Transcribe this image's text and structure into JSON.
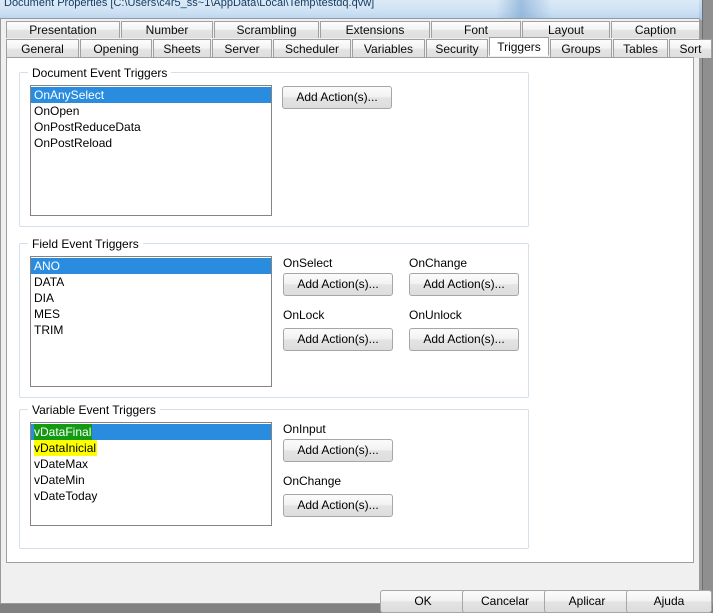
{
  "window": {
    "title": "Document Properties [C:\\Users\\c4r5_ss~1\\AppData\\Local\\Temp\\testdq.qvw]"
  },
  "tabs": {
    "row1": [
      {
        "label": "Presentation",
        "selected": false
      },
      {
        "label": "Number",
        "selected": false
      },
      {
        "label": "Scrambling",
        "selected": false
      },
      {
        "label": "Extensions",
        "selected": false
      },
      {
        "label": "Font",
        "selected": false
      },
      {
        "label": "Layout",
        "selected": false
      },
      {
        "label": "Caption",
        "selected": false
      }
    ],
    "row2": [
      {
        "label": "General",
        "selected": false
      },
      {
        "label": "Opening",
        "selected": false
      },
      {
        "label": "Sheets",
        "selected": false
      },
      {
        "label": "Server",
        "selected": false
      },
      {
        "label": "Scheduler",
        "selected": false
      },
      {
        "label": "Variables",
        "selected": false
      },
      {
        "label": "Security",
        "selected": false
      },
      {
        "label": "Triggers",
        "selected": true
      },
      {
        "label": "Groups",
        "selected": false
      },
      {
        "label": "Tables",
        "selected": false
      },
      {
        "label": "Sort",
        "selected": false
      }
    ]
  },
  "document_group": {
    "title": "Document Event Triggers",
    "items": [
      {
        "label": "OnAnySelect",
        "selected": true,
        "highlight": "none"
      },
      {
        "label": "OnOpen",
        "selected": false,
        "highlight": "none"
      },
      {
        "label": "OnPostReduceData",
        "selected": false,
        "highlight": "none"
      },
      {
        "label": "OnPostReload",
        "selected": false,
        "highlight": "none"
      }
    ],
    "add_action_label": "Add Action(s)..."
  },
  "field_group": {
    "title": "Field Event Triggers",
    "items": [
      {
        "label": "ANO",
        "selected": true,
        "highlight": "none"
      },
      {
        "label": "DATA",
        "selected": false,
        "highlight": "none"
      },
      {
        "label": "DIA",
        "selected": false,
        "highlight": "none"
      },
      {
        "label": "MES",
        "selected": false,
        "highlight": "none"
      },
      {
        "label": "TRIM",
        "selected": false,
        "highlight": "none"
      }
    ],
    "events": [
      {
        "name": "OnSelect",
        "button": "Add Action(s)..."
      },
      {
        "name": "OnChange",
        "button": "Add Action(s)..."
      },
      {
        "name": "OnLock",
        "button": "Add Action(s)..."
      },
      {
        "name": "OnUnlock",
        "button": "Add Action(s)..."
      }
    ]
  },
  "variable_group": {
    "title": "Variable Event Triggers",
    "items": [
      {
        "label": "vDataFinal",
        "selected": true,
        "highlight": "green"
      },
      {
        "label": "vDataInicial",
        "selected": false,
        "highlight": "yellow"
      },
      {
        "label": "vDateMax",
        "selected": false,
        "highlight": "none"
      },
      {
        "label": "vDateMin",
        "selected": false,
        "highlight": "none"
      },
      {
        "label": "vDateToday",
        "selected": false,
        "highlight": "none"
      }
    ],
    "events": [
      {
        "name": "OnInput",
        "button": "Add Action(s)..."
      },
      {
        "name": "OnChange",
        "button": "Add Action(s)..."
      }
    ]
  },
  "footer": {
    "buttons": [
      {
        "label": "OK"
      },
      {
        "label": "Cancelar"
      },
      {
        "label": "Aplicar"
      },
      {
        "label": "Ajuda"
      }
    ]
  },
  "colors": {
    "selection_blue": "#2a8cdf",
    "highlight_green": "#139a13",
    "highlight_yellow": "#ffff00",
    "dialog_face": "#f0f0f0",
    "group_border": "#d6e0ea"
  }
}
